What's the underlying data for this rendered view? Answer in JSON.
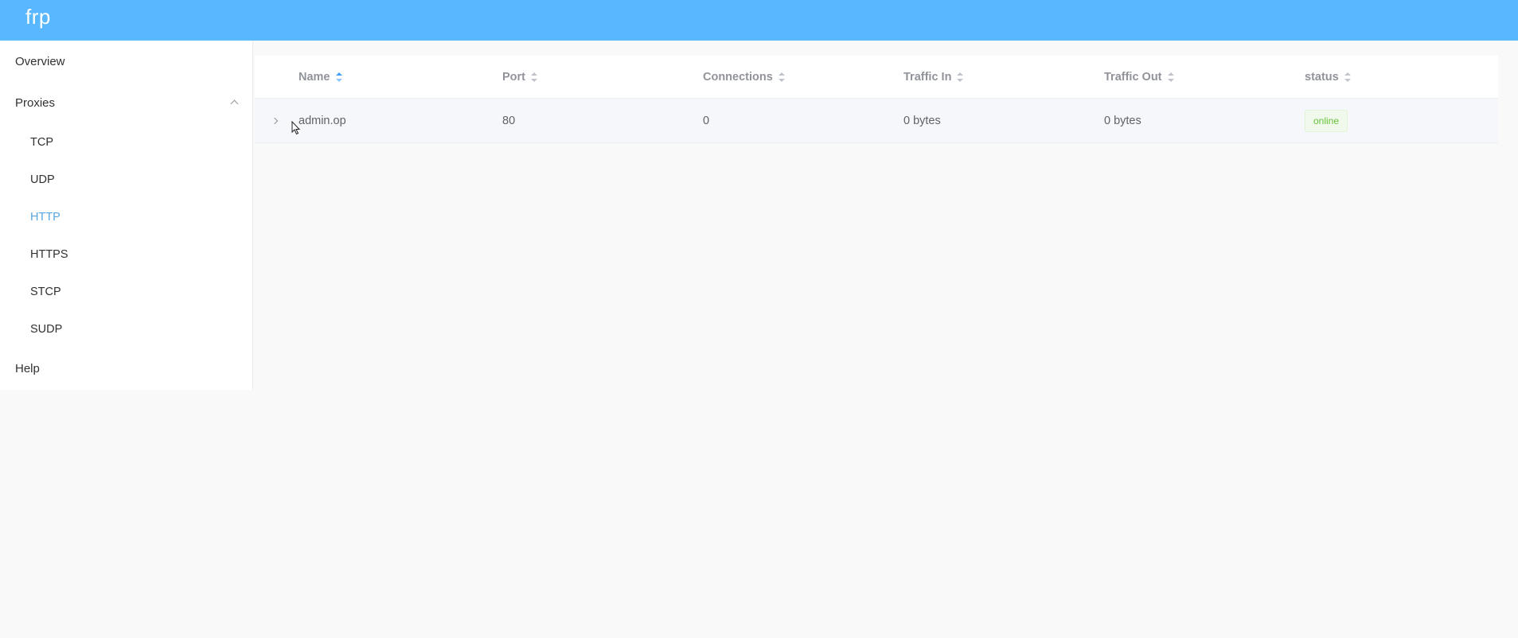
{
  "app": {
    "brand": "frp"
  },
  "sidebar": {
    "overview": "Overview",
    "proxies": "Proxies",
    "sub_items": [
      "TCP",
      "UDP",
      "HTTP",
      "HTTPS",
      "STCP",
      "SUDP"
    ],
    "active_item": "HTTP",
    "help": "Help"
  },
  "table": {
    "columns": [
      "Name",
      "Port",
      "Connections",
      "Traffic In",
      "Traffic Out",
      "status"
    ],
    "sorted_column": "Name",
    "rows": [
      {
        "name": "admin.op",
        "port": "80",
        "connections": "0",
        "traffic_in": "0 bytes",
        "traffic_out": "0 bytes",
        "status": "online"
      }
    ]
  },
  "colors": {
    "header": "#58b7ff",
    "active_menu": "#58a6e0",
    "status_online": "#67c23a"
  },
  "icons": [
    "chevron-up-icon",
    "sort-caret-icon",
    "chevron-right-icon",
    "mouse-cursor-icon"
  ]
}
